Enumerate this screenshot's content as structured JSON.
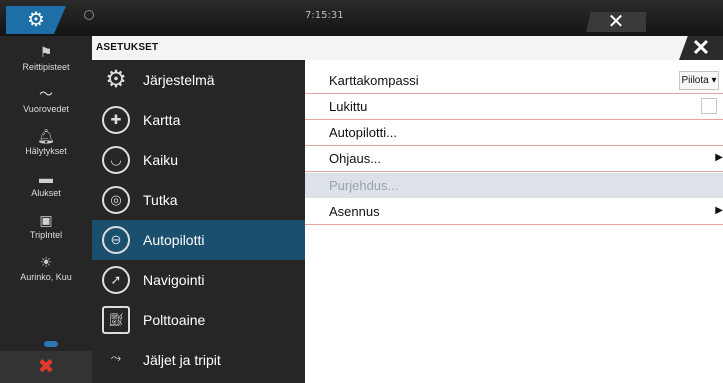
{
  "topbar": {
    "time": "7:15:31"
  },
  "rail": {
    "items": [
      {
        "label": "Reittipisteet",
        "icon": "flag-icon"
      },
      {
        "label": "Vuorovedet",
        "icon": "wave-icon"
      },
      {
        "label": "Hälytykset",
        "icon": "bell-icon"
      },
      {
        "label": "Alukset",
        "icon": "vessels-icon"
      },
      {
        "label": "TripIntel",
        "icon": "tripintel-icon"
      },
      {
        "label": "Aurinko, Kuu",
        "icon": "sun-moon-icon"
      }
    ]
  },
  "dialog": {
    "title": "ASETUKSET",
    "categories": [
      {
        "label": "Järjestelmä",
        "icon": "gear-icon",
        "active": false
      },
      {
        "label": "Kartta",
        "icon": "chart-icon",
        "active": false
      },
      {
        "label": "Kaiku",
        "icon": "echo-icon",
        "active": false
      },
      {
        "label": "Tutka",
        "icon": "radar-icon",
        "active": false
      },
      {
        "label": "Autopilotti",
        "icon": "steering-wheel-icon",
        "active": true
      },
      {
        "label": "Navigointi",
        "icon": "compass-icon",
        "active": false
      },
      {
        "label": "Polttoaine",
        "icon": "fuel-icon",
        "active": false
      },
      {
        "label": "Jäljet ja tripit",
        "icon": "trails-icon",
        "active": false
      }
    ],
    "options": [
      {
        "label": "Karttakompassi",
        "control": "dropdown",
        "value": "Piilota"
      },
      {
        "label": "Lukittu",
        "control": "checkbox",
        "checked": false
      },
      {
        "label": "Autopilotti...",
        "control": "none"
      },
      {
        "label": "Ohjaus...",
        "control": "submenu"
      },
      {
        "label": "Purjehdus...",
        "control": "none",
        "disabled": true
      },
      {
        "label": "Asennus",
        "control": "submenu"
      }
    ]
  },
  "colors": {
    "accent": "#1e6fa8",
    "selected": "#1a4f6e",
    "close_red": "#e0392b"
  }
}
